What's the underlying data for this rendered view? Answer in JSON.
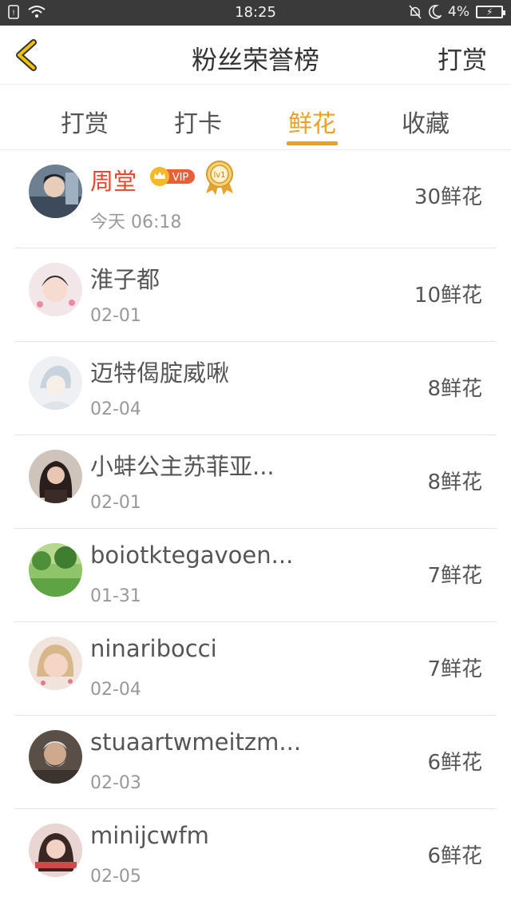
{
  "status_bar": {
    "time": "18:25",
    "battery": "4%"
  },
  "header": {
    "title": "粉丝荣誉榜",
    "right_action": "打赏"
  },
  "tabs": [
    {
      "label": "打赏",
      "active": false
    },
    {
      "label": "打卡",
      "active": false
    },
    {
      "label": "鲜花",
      "active": true
    },
    {
      "label": "收藏",
      "active": false
    }
  ],
  "vip_label": "VIP",
  "level_label": "lv1",
  "fans": [
    {
      "name": "周堂",
      "date": "今天 06:18",
      "amount": "30鲜花"
    },
    {
      "name": "淮子都",
      "date": "02-01",
      "amount": "10鲜花"
    },
    {
      "name": "迈特偈腚威啾",
      "date": "02-04",
      "amount": "8鲜花"
    },
    {
      "name": "小蚌公主苏菲亚...",
      "date": "02-01",
      "amount": "8鲜花"
    },
    {
      "name": "boiotktegavoen...",
      "date": "01-31",
      "amount": "7鲜花"
    },
    {
      "name": "ninaribocci",
      "date": "02-04",
      "amount": "7鲜花"
    },
    {
      "name": "stuaartwmeitzm...",
      "date": "02-03",
      "amount": "6鲜花"
    },
    {
      "name": "minijcwfm",
      "date": "02-05",
      "amount": "6鲜花"
    }
  ],
  "colors": {
    "accent": "#f0a020",
    "highlight_name": "#e8452d",
    "status_bar": "#3a3a3a"
  }
}
